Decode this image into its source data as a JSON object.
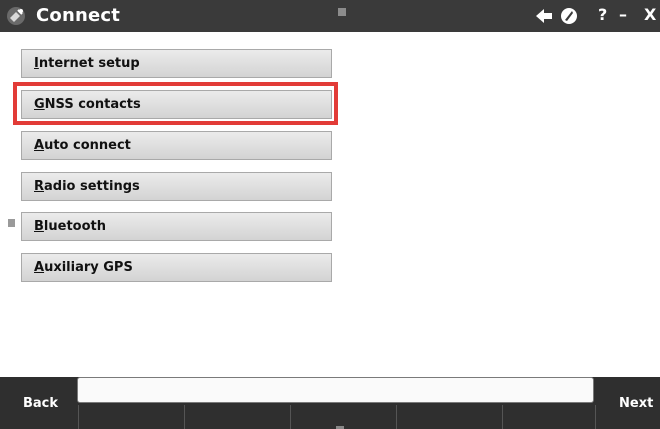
{
  "window": {
    "title": "Connect",
    "help_label": "?",
    "minimize_label": "–",
    "close_label": "X"
  },
  "icons": {
    "app": "satellite-icon",
    "toolbar_left": "back-arrow-icon",
    "toolbar_right": "compass-icon"
  },
  "menu": {
    "items": [
      {
        "mnemonic": "I",
        "rest": "nternet setup"
      },
      {
        "mnemonic": "G",
        "rest": "NSS contacts"
      },
      {
        "mnemonic": "A",
        "rest": "uto connect"
      },
      {
        "mnemonic": "R",
        "rest": "adio settings"
      },
      {
        "mnemonic": "B",
        "rest": "luetooth"
      },
      {
        "mnemonic": "A",
        "rest": "uxiliary GPS"
      }
    ],
    "highlighted_index": 1
  },
  "footer": {
    "back_label": "Back",
    "next_label": "Next",
    "status_value": ""
  },
  "colors": {
    "titlebar": "#3a3a3a",
    "highlight": "#e23b37",
    "footer": "#2f2f2f"
  }
}
